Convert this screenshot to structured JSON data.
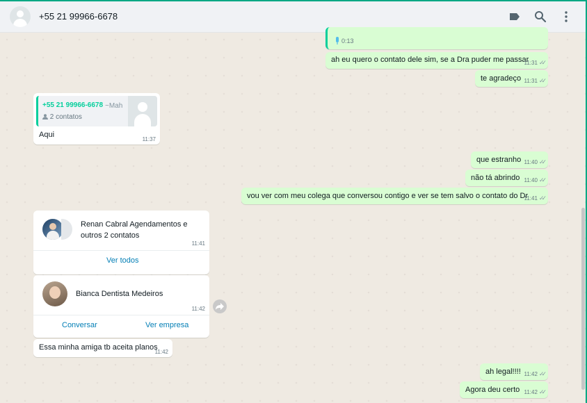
{
  "header": {
    "title": "+55 21 99966-6678"
  },
  "messages": {
    "audio_duration": "0:13",
    "m1": {
      "text": "ah eu quero o contato dele sim, se a Dra puder me passar",
      "time": "11:31",
      "ticks": "✓✓"
    },
    "m2": {
      "text": "te agradeço",
      "time": "11:31",
      "ticks": "✓✓"
    },
    "quoted": {
      "name": "+55 21 99966-6678",
      "push_name": "~Mah",
      "sub": "2 contatos"
    },
    "m3": {
      "text": "Aqui",
      "time": "11:37"
    },
    "m4": {
      "text": "que estranho",
      "time": "11:40",
      "ticks": "✓✓"
    },
    "m5": {
      "text": "não tá abrindo",
      "time": "11:40",
      "ticks": "✓✓"
    },
    "m6": {
      "text": "vou ver com meu colega que conversou contigo e ver se tem salvo o contato do Dr",
      "time": "11:41",
      "ticks": "✓✓"
    },
    "contacts_card": {
      "name": "Renan Cabral Agendamentos e outros 2 contatos",
      "time": "11:41",
      "action": "Ver todos"
    },
    "contact_card": {
      "name": "Bianca Dentista Medeiros",
      "time": "11:42",
      "action1": "Conversar",
      "action2": "Ver empresa"
    },
    "m7": {
      "text": "Essa minha amiga tb aceita planos",
      "time": "11:42"
    },
    "m8": {
      "text": "ah legal!!!!",
      "time": "11:42",
      "ticks": "✓✓"
    },
    "m9": {
      "text": "Agora deu certo",
      "time": "11:42",
      "ticks": "✓✓"
    }
  },
  "colors": {
    "accent": "#00a884",
    "outgoing": "#d9fdd3",
    "incoming": "#ffffff",
    "link": "#027eb5"
  }
}
